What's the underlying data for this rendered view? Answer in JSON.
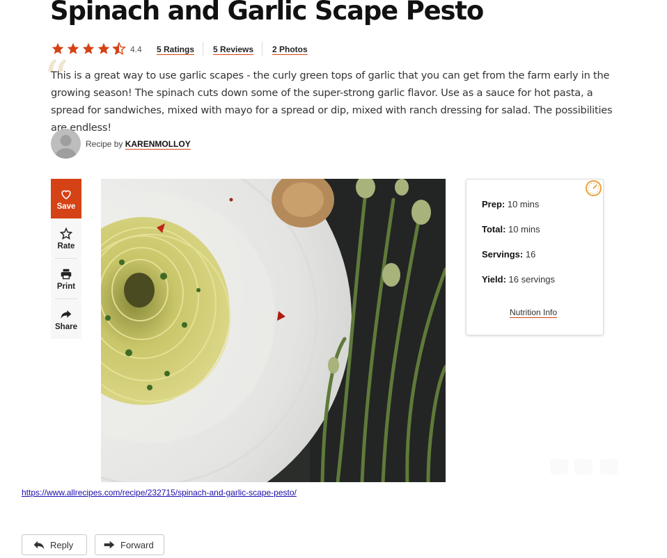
{
  "recipe": {
    "title": "Spinach and Garlic Scape Pesto",
    "rating_value": "4.4",
    "ratings_label": "5 Ratings",
    "reviews_label": "5 Reviews",
    "photos_label": "2 Photos",
    "description": "This is a great way to use garlic scapes - the curly green tops of garlic that you can get from the farm early in the growing season! The spinach cuts down some of the super-strong garlic flavor. Use as a sauce for hot pasta, a spread for sandwiches, mixed with mayo for a spread or dip, mixed with ranch dressing for salad. The possibilities are endless!",
    "byline_prefix": "Recipe by",
    "author": "KARENMOLLOY"
  },
  "actions": {
    "save": "Save",
    "rate": "Rate",
    "print": "Print",
    "share": "Share"
  },
  "info_card": {
    "prep_label": "Prep:",
    "prep_value": "10 mins",
    "total_label": "Total:",
    "total_value": "10 mins",
    "servings_label": "Servings:",
    "servings_value": "16",
    "yield_label": "Yield:",
    "yield_value": "16 servings",
    "nutrition_link": "Nutrition Info"
  },
  "email": {
    "url": "https://www.allrecipes.com/recipe/232715/spinach-and-garlic-scape-pesto/",
    "reply_label": "Reply",
    "forward_label": "Forward"
  },
  "colors": {
    "accent": "#d54215",
    "clock_icon": "#e8a33d",
    "link": "#1a0dab"
  },
  "icons": {
    "rating": "star-icon",
    "save": "heart-icon",
    "rate": "star-outline-icon",
    "print": "printer-icon",
    "share": "share-arrow-icon",
    "time": "clock-icon",
    "reply": "reply-arrow-icon",
    "forward": "forward-arrow-icon"
  },
  "rating_stars": 4.4
}
